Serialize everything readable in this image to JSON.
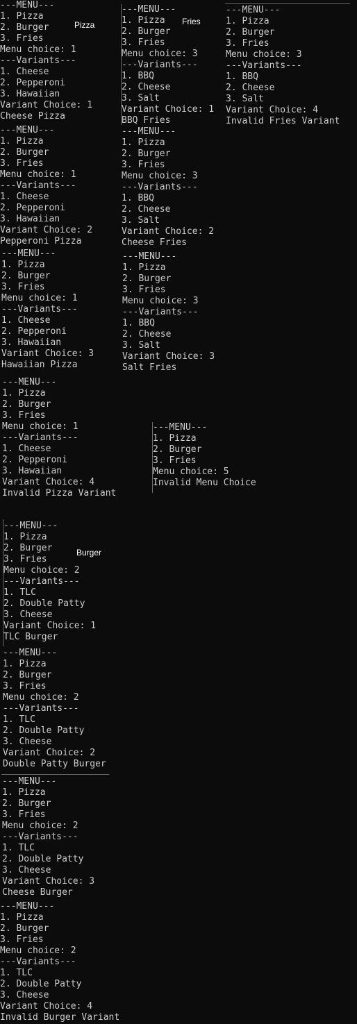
{
  "captions": {
    "pizza": "Pizza",
    "fries": "Fries",
    "burger": "Burger"
  },
  "sessions": {
    "pizza_1": [
      "---MENU---",
      "1. Pizza",
      "2. Burger",
      "3. Fries",
      "Menu choice: 1",
      "---Variants---",
      "1. Cheese",
      "2. Pepperoni",
      "3. Hawaiian",
      "Variant Choice: 1",
      "Cheese Pizza"
    ],
    "pizza_2": [
      "---MENU---",
      "1. Pizza",
      "2. Burger",
      "3. Fries",
      "Menu choice: 1",
      "---Variants---",
      "1. Cheese",
      "2. Pepperoni",
      "3. Hawaiian",
      "Variant Choice: 2",
      "Pepperoni Pizza"
    ],
    "pizza_3": [
      "---MENU---",
      "1. Pizza",
      "2. Burger",
      "3. Fries",
      "Menu choice: 1",
      "---Variants---",
      "1. Cheese",
      "2. Pepperoni",
      "3. Hawaiian",
      "Variant Choice: 3",
      "Hawaiian Pizza"
    ],
    "pizza_4": [
      "---MENU---",
      "1. Pizza",
      "2. Burger",
      "3. Fries",
      "Menu choice: 1",
      "---Variants---",
      "1. Cheese",
      "2. Pepperoni",
      "3. Hawaiian",
      "Variant Choice: 4",
      "Invalid Pizza Variant"
    ],
    "fries_1": [
      "---MENU---",
      "1. Pizza",
      "2. Burger",
      "3. Fries",
      "Menu choice: 3",
      "---Variants---",
      "1. BBQ",
      "2. Cheese",
      "3. Salt",
      "Variant Choice: 1",
      "BBQ Fries"
    ],
    "fries_2": [
      "---MENU---",
      "1. Pizza",
      "2. Burger",
      "3. Fries",
      "Menu choice: 3",
      "---Variants---",
      "1. BBQ",
      "2. Cheese",
      "3. Salt",
      "Variant Choice: 2",
      "Cheese Fries"
    ],
    "fries_3": [
      "---MENU---",
      "1. Pizza",
      "2. Burger",
      "3. Fries",
      "Menu choice: 3",
      "---Variants---",
      "1. BBQ",
      "2. Cheese",
      "3. Salt",
      "Variant Choice: 3",
      "Salt Fries"
    ],
    "fries_4": [
      "---MENU---",
      "1. Pizza",
      "2. Burger",
      "3. Fries",
      "Menu choice: 3",
      "---Variants---",
      "1. BBQ",
      "2. Cheese",
      "3. Salt",
      "Variant Choice: 4",
      "Invalid Fries Variant"
    ],
    "invalid_menu": [
      "---MENU---",
      "1. Pizza",
      "2. Burger",
      "3. Fries",
      "Menu choice: 5",
      "Invalid Menu Choice"
    ],
    "burger_1": [
      "---MENU---",
      "1. Pizza",
      "2. Burger",
      "3. Fries",
      "Menu choice: 2",
      "---Variants---",
      "1. TLC",
      "2. Double Patty",
      "3. Cheese",
      "Variant Choice: 1",
      "TLC Burger"
    ],
    "burger_2": [
      "---MENU---",
      "1. Pizza",
      "2. Burger",
      "3. Fries",
      "Menu choice: 2",
      "---Variants---",
      "1. TLC",
      "2. Double Patty",
      "3. Cheese",
      "Variant Choice: 2",
      "Double Patty Burger"
    ],
    "burger_3": [
      "---MENU---",
      "1. Pizza",
      "2. Burger",
      "3. Fries",
      "Menu choice: 2",
      "---Variants---",
      "1. TLC",
      "2. Double Patty",
      "3. Cheese",
      "Variant Choice: 3",
      "Cheese Burger"
    ],
    "burger_4": [
      "---MENU---",
      "1. Pizza",
      "2. Burger",
      "3. Fries",
      "Menu choice: 2",
      "---Variants---",
      "1. TLC",
      "2. Double Patty",
      "3. Cheese",
      "Variant Choice: 4",
      "Invalid Burger Variant"
    ]
  },
  "colors": {
    "background": "#0c0c0c",
    "terminal_text": "#cccccc",
    "caption_text": "#ffffff"
  }
}
